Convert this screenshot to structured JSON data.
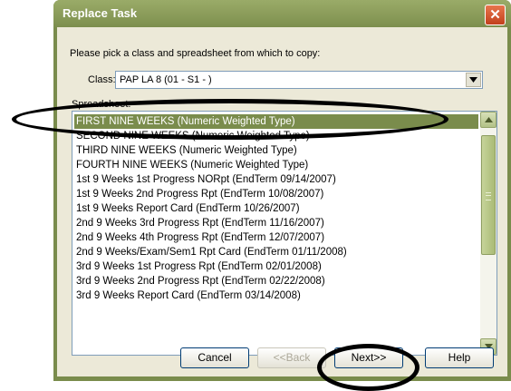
{
  "window": {
    "title": "Replace Task"
  },
  "prompt": "Please pick a class and spreadsheet from which to copy:",
  "class_field": {
    "label": "Class:",
    "value": "PAP LA 8 (01 - S1 - )"
  },
  "spreadsheet_label": "Spreadsheet:",
  "spreadsheets": [
    {
      "label": "FIRST NINE WEEKS (Numeric Weighted Type)",
      "selected": true
    },
    {
      "label": "SECOND NINE WEEKS (Numeric Weighted Type)",
      "selected": false
    },
    {
      "label": "THIRD NINE WEEKS (Numeric Weighted Type)",
      "selected": false
    },
    {
      "label": "FOURTH NINE WEEKS (Numeric Weighted Type)",
      "selected": false
    },
    {
      "label": "1st 9 Weeks 1st Progress NORpt (EndTerm 09/14/2007)",
      "selected": false
    },
    {
      "label": "1st 9 Weeks 2nd Progress Rpt (EndTerm 10/08/2007)",
      "selected": false
    },
    {
      "label": "1st 9 Weeks Report Card (EndTerm 10/26/2007)",
      "selected": false
    },
    {
      "label": "2nd 9 Weeks 3rd Progress Rpt (EndTerm 11/16/2007)",
      "selected": false
    },
    {
      "label": "2nd 9 Weeks 4th Progress Rpt (EndTerm 12/07/2007)",
      "selected": false
    },
    {
      "label": "2nd 9 Weeks/Exam/Sem1 Rpt Card (EndTerm 01/11/2008)",
      "selected": false
    },
    {
      "label": "3rd 9 Weeks 1st Progress Rpt (EndTerm 02/01/2008)",
      "selected": false
    },
    {
      "label": "3rd 9 Weeks 2nd Progress Rpt (EndTerm 02/22/2008)",
      "selected": false
    },
    {
      "label": "3rd 9 Weeks Report Card (EndTerm 03/14/2008)",
      "selected": false
    }
  ],
  "buttons": {
    "cancel": "Cancel",
    "back": "<<Back",
    "next": "Next>>",
    "help": "Help"
  },
  "colors": {
    "selection": "#7a8c4c",
    "title_bar": "#7d8f4e",
    "annotation_ellipse": "#000000"
  }
}
